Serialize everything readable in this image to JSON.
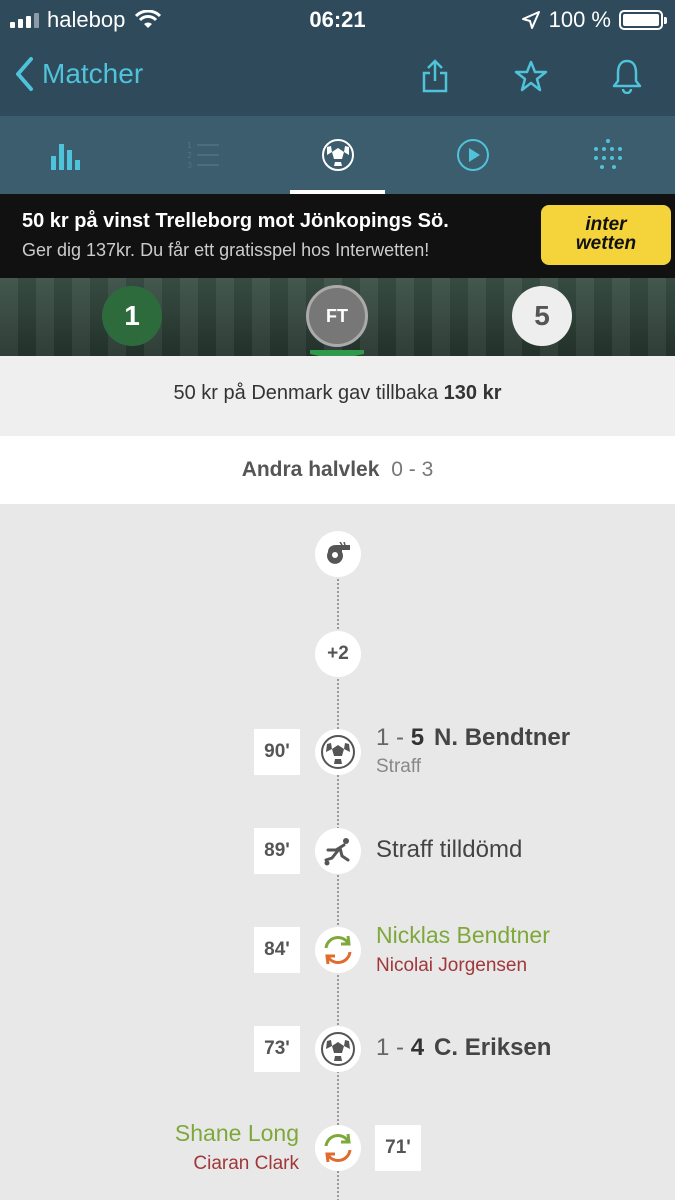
{
  "status_bar": {
    "carrier": "halebop",
    "time": "06:21",
    "battery": "100 %",
    "icons": [
      "signal-icon",
      "wifi-icon",
      "location-arrow-icon",
      "battery-icon"
    ]
  },
  "nav": {
    "back_label": "Matcher",
    "icons": [
      "share-icon",
      "star-icon",
      "bell-icon"
    ],
    "accent_color": "#4fc3da"
  },
  "tabs": [
    {
      "name": "stats-icon",
      "active": false
    },
    {
      "name": "standings-icon",
      "active": false
    },
    {
      "name": "ball-icon",
      "active": true
    },
    {
      "name": "play-icon",
      "active": false
    },
    {
      "name": "lineup-icon",
      "active": false
    }
  ],
  "ad": {
    "title": "50 kr på vinst Trelleborg mot Jönkopings Sö.",
    "subtitle": "Ger dig 137kr. Du får ett gratisspel hos Interwetten!",
    "logo_line1": "inter",
    "logo_line2": "wetten"
  },
  "scoreboard": {
    "home_score": "1",
    "status": "FT",
    "away_score": "5"
  },
  "bet": {
    "text": "50 kr på Denmark gav tillbaka",
    "amount": "130 kr"
  },
  "half": {
    "label": "Andra halvlek",
    "score": "0 - 3"
  },
  "timeline": {
    "added_time": "+2",
    "events": [
      {
        "minute": "90'",
        "type": "goal",
        "score_home": "1",
        "score_away": "5",
        "player": "N. Bendtner",
        "detail": "Straff"
      },
      {
        "minute": "89'",
        "type": "penalty",
        "text": "Straff tilldömd"
      },
      {
        "minute": "84'",
        "type": "substitution",
        "player_in": "Nicklas Bendtner",
        "player_out": "Nicolai Jorgensen"
      },
      {
        "minute": "73'",
        "type": "goal",
        "score_home": "1",
        "score_away": "4",
        "player": "C. Eriksen"
      },
      {
        "minute": "71'",
        "type": "substitution",
        "player_in": "Shane Long",
        "player_out": "Ciaran Clark"
      }
    ]
  }
}
